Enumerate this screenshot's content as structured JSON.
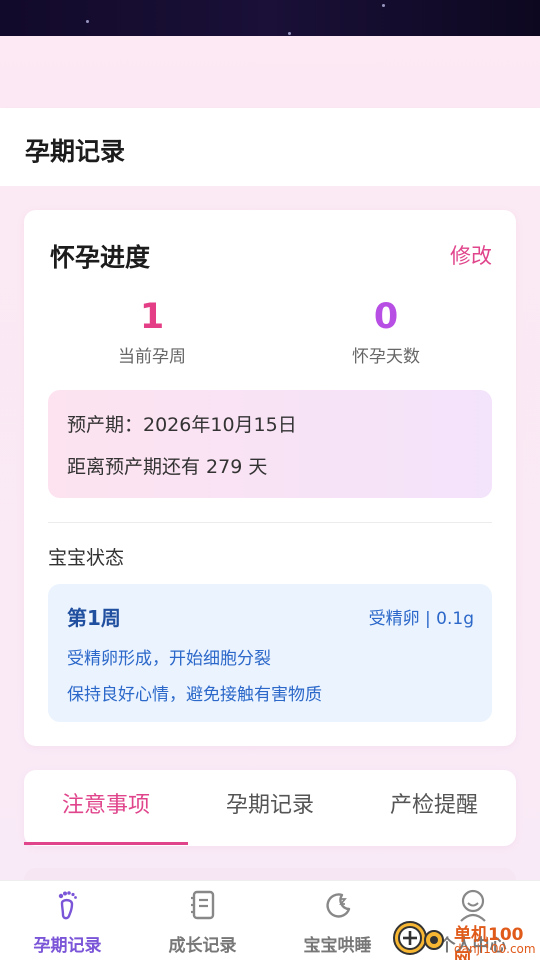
{
  "header": {
    "title": "孕期记录"
  },
  "progress_card": {
    "heading": "怀孕进度",
    "edit_label": "修改",
    "current_week": {
      "value": "1",
      "label": "当前孕周"
    },
    "pregnant_days": {
      "value": "0",
      "label": "怀孕天数"
    },
    "due_date_text": "预产期：2026年10月15日",
    "days_left_text": "距离预产期还有 279 天"
  },
  "baby_status": {
    "title": "宝宝状态",
    "week": "第1周",
    "size": "受精卵 | 0.1g",
    "desc1": "受精卵形成，开始细胞分裂",
    "desc2": "保持良好心情，避免接触有害物质"
  },
  "tabs": [
    {
      "label": "注意事项",
      "active": true
    },
    {
      "label": "孕期记录",
      "active": false
    },
    {
      "label": "产检提醒",
      "active": false
    }
  ],
  "bottom_nav": [
    {
      "label": "孕期记录",
      "icon": "footprint-icon",
      "active": true
    },
    {
      "label": "成长记录",
      "icon": "notebook-icon",
      "active": false
    },
    {
      "label": "宝宝哄睡",
      "icon": "moon-icon",
      "active": false
    },
    {
      "label": "个人中心",
      "icon": "person-icon",
      "active": false
    }
  ],
  "watermark": {
    "brand": "单机100网",
    "url": "danji100.com"
  },
  "colors": {
    "accent_pink": "#e0458c",
    "accent_purple": "#b84fe4",
    "nav_active": "#7b55d8",
    "baby_text": "#2b68c9"
  }
}
